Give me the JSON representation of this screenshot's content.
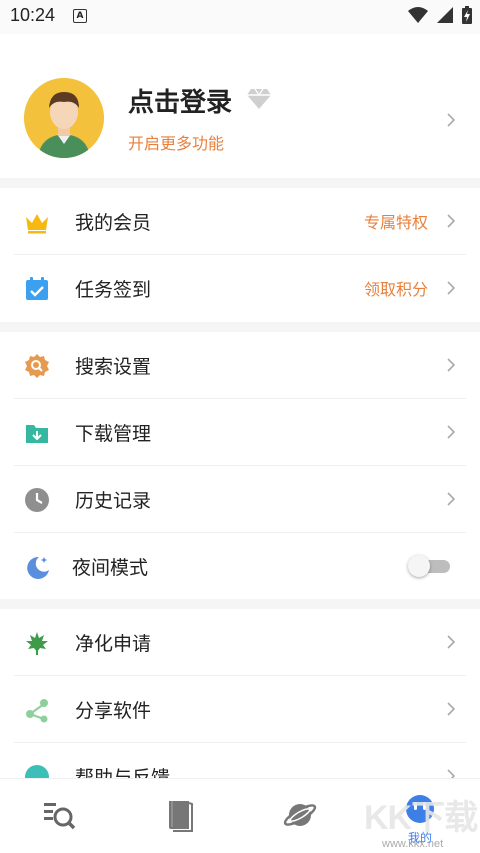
{
  "status_bar": {
    "time": "10:24",
    "notif_letter": "A",
    "icons": [
      "wifi-icon",
      "signal-icon",
      "battery-icon"
    ]
  },
  "profile": {
    "title": "点击登录",
    "subtitle": "开启更多功能"
  },
  "menu_group_1": [
    {
      "label": "我的会员",
      "extra": "专属特权",
      "icon": "crown-icon"
    },
    {
      "label": "任务签到",
      "extra": "领取积分",
      "icon": "calendar-check-icon"
    }
  ],
  "menu_group_2": [
    {
      "label": "搜索设置",
      "icon": "search-settings-icon"
    },
    {
      "label": "下载管理",
      "icon": "download-folder-icon"
    },
    {
      "label": "历史记录",
      "icon": "clock-icon"
    },
    {
      "label": "夜间模式",
      "icon": "moon-icon",
      "toggle": false
    }
  ],
  "menu_group_3": [
    {
      "label": "净化申请",
      "icon": "leaf-icon"
    },
    {
      "label": "分享软件",
      "icon": "share-icon"
    },
    {
      "label": "帮助与反馈",
      "icon": "help-icon"
    }
  ],
  "bottom_nav": {
    "items": [
      {
        "icon": "discover-search-icon",
        "label": ""
      },
      {
        "icon": "book-icon",
        "label": ""
      },
      {
        "icon": "planet-icon",
        "label": ""
      },
      {
        "icon": "profile-icon",
        "label": "我的",
        "active": true
      }
    ]
  },
  "watermark": {
    "text": "KK下载",
    "url": "www.kkx.net"
  },
  "colors": {
    "accent_orange": "#e8813d",
    "active_blue": "#3d7fe6",
    "section_gap": "#f5f5f5"
  }
}
